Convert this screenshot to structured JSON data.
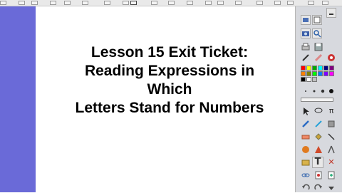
{
  "slide": {
    "title_lines": [
      "Lesson 15 Exit Ticket:",
      "Reading Expressions in",
      "Which",
      "Letters Stand for Numbers"
    ]
  },
  "toolbox": {
    "text_tool_label": "T",
    "pi_label": "π",
    "delete_label": "✕",
    "palette": [
      "#ff0000",
      "#ffff00",
      "#00aa00",
      "#00ffff",
      "#000080",
      "#800080",
      "#ff8000",
      "#808000",
      "#00ff00",
      "#0080ff",
      "#8000ff",
      "#ff00ff",
      "#000000",
      "#ffffff",
      "#c0c0c0"
    ],
    "accent": "#6a6ad8"
  }
}
